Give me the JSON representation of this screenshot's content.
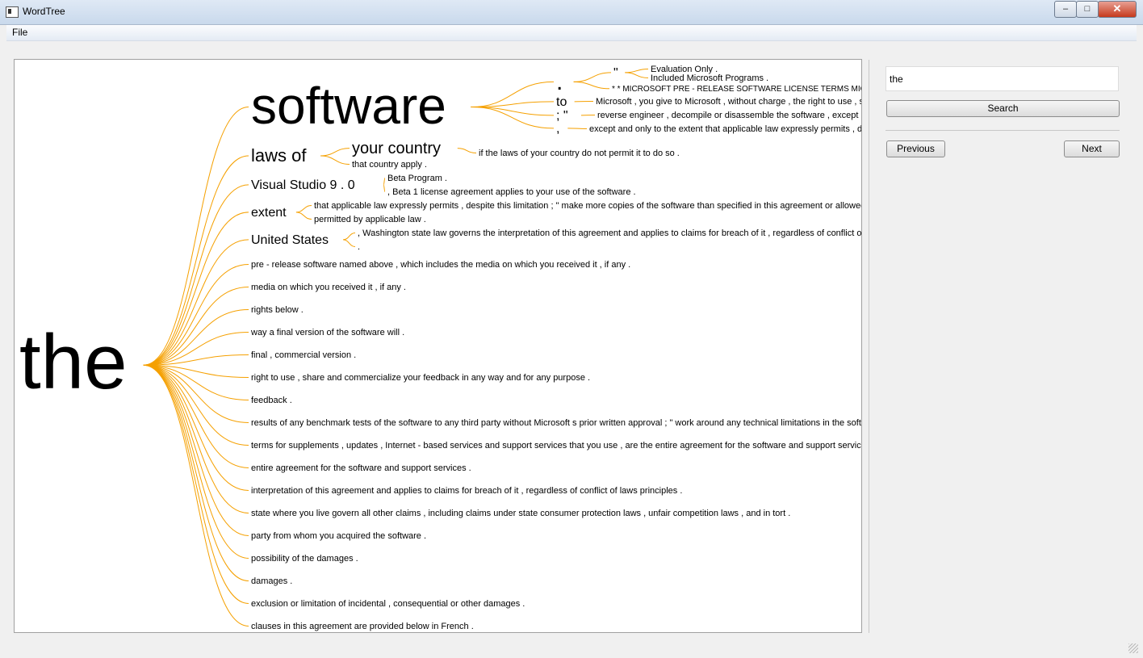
{
  "window": {
    "title": "WordTree",
    "minimize": "–",
    "maximize": "□",
    "close": "✕"
  },
  "menu": {
    "file": "File"
  },
  "search": {
    "value": "the",
    "button": "Search"
  },
  "nav": {
    "previous": "Previous",
    "next": "Next"
  },
  "colors": {
    "branch": "#f5a000",
    "text": "#000000"
  },
  "tree": {
    "root": "the",
    "branches": [
      {
        "text": "software",
        "level": 1,
        "size": 64,
        "children": [
          {
            "text": ".",
            "size": 30,
            "children": [
              {
                "text": "\"",
                "size": 16,
                "children": [
                  {
                    "text": "Evaluation Only .",
                    "size": 11
                  },
                  {
                    "text": "Included Microsoft Programs .",
                    "size": 11
                  }
                ]
              },
              {
                "text": "* * MICROSOFT PRE - RELEASE SOFTWARE LICENSE TERMS MICROSOFT",
                "size": 10
              }
            ]
          },
          {
            "text": "to",
            "size": 16,
            "children": [
              {
                "text": "Microsoft , you give to Microsoft , without charge , the right to use , share",
                "size": 11
              }
            ]
          },
          {
            "text": "; \"",
            "size": 16,
            "children": [
              {
                "text": "reverse engineer , decompile or disassemble the software , except and",
                "size": 11
              }
            ]
          },
          {
            "text": ",",
            "size": 16,
            "children": [
              {
                "text": "except and only to the extent that applicable law expressly permits , despite",
                "size": 11
              }
            ]
          }
        ]
      },
      {
        "text": "laws of",
        "size": 22,
        "children": [
          {
            "text": "your country",
            "size": 20,
            "children": [
              {
                "text": "if the laws of your country do not permit it to do so .",
                "size": 11
              }
            ]
          },
          {
            "text": "that country apply .",
            "size": 11
          }
        ]
      },
      {
        "text": "Visual Studio 9 . 0",
        "size": 16,
        "children": [
          {
            "text": "Beta Program .",
            "size": 11
          },
          {
            "text": ", Beta 1 license agreement applies to your use of the software .",
            "size": 11
          }
        ]
      },
      {
        "text": "extent",
        "size": 16,
        "children": [
          {
            "text": "that applicable law expressly permits , despite this limitation ; \" make more copies of the software than specified in this agreement or allowed by",
            "size": 11
          },
          {
            "text": "permitted by applicable law .",
            "size": 11
          }
        ]
      },
      {
        "text": "United States",
        "size": 16,
        "children": [
          {
            "text": ", Washington state law governs the interpretation of this agreement and applies to claims for breach of it , regardless of conflict of laws",
            "size": 11
          },
          {
            "text": ".",
            "size": 11
          }
        ]
      },
      {
        "text": "pre - release software named above , which includes the media on which you received it , if any .",
        "size": 11
      },
      {
        "text": "media on which you received it , if any .",
        "size": 11
      },
      {
        "text": "rights below .",
        "size": 11
      },
      {
        "text": "way a final version of the software will .",
        "size": 11
      },
      {
        "text": "final , commercial version .",
        "size": 11
      },
      {
        "text": "right to use , share and commercialize your feedback in any way and for any purpose .",
        "size": 11
      },
      {
        "text": "feedback .",
        "size": 11
      },
      {
        "text": "results of any benchmark tests of the software to any third party without Microsoft s prior written approval ; \" work around any technical limitations in the software",
        "size": 11
      },
      {
        "text": "terms for supplements , updates , Internet - based services and support services that you use , are the entire agreement for the software and support services",
        "size": 11
      },
      {
        "text": "entire agreement for the software and support services .",
        "size": 11
      },
      {
        "text": "interpretation of this agreement and applies to claims for breach of it , regardless of conflict of laws principles .",
        "size": 11
      },
      {
        "text": "state where you live govern all other claims , including claims under state consumer protection laws , unfair competition laws , and in tort .",
        "size": 11
      },
      {
        "text": "party from whom you acquired the software .",
        "size": 11
      },
      {
        "text": "possibility of the damages .",
        "size": 11
      },
      {
        "text": "damages .",
        "size": 11
      },
      {
        "text": "exclusion or limitation of incidental , consequential or other damages .",
        "size": 11
      },
      {
        "text": "clauses in this agreement are provided below in French .",
        "size": 11
      }
    ]
  }
}
